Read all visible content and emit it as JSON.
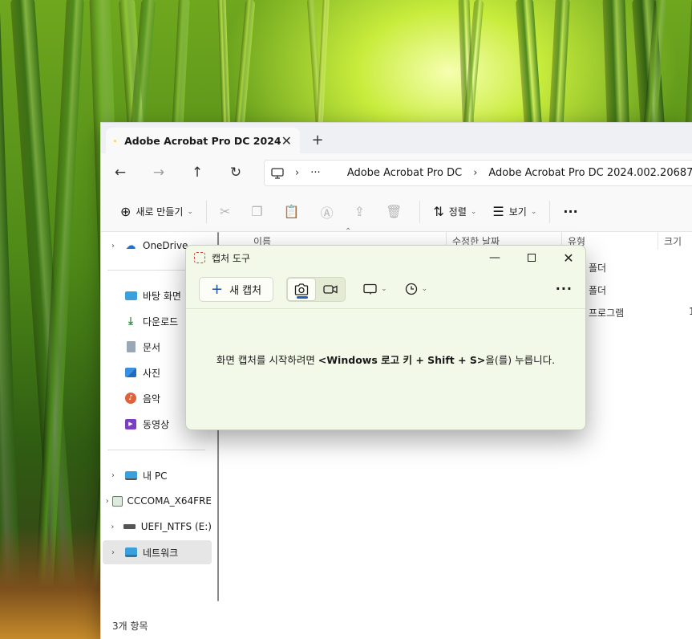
{
  "explorer": {
    "tab_title": "Adobe Acrobat Pro DC 2024",
    "tab_close": "✕",
    "new_tab": "+",
    "breadcrumb": {
      "overflow": "···",
      "items": [
        "Adobe Acrobat Pro DC",
        "Adobe Acrobat Pro DC 2024.002.20687"
      ]
    },
    "commands": {
      "new": "새로 만들기",
      "sort": "정렬",
      "view": "보기",
      "more": "···"
    },
    "sidebar": {
      "onedrive": "OneDrive",
      "quick": [
        "바탕 화면",
        "다운로드",
        "문서",
        "사진",
        "음악",
        "동영상"
      ],
      "devices": [
        "내 PC",
        "CCCOMA_X64FRE",
        "UEFI_NTFS (E:)",
        "네트워크"
      ]
    },
    "columns": {
      "name": "이름",
      "modified": "수정한 날짜",
      "type": "유형",
      "size": "크기"
    },
    "rows": [
      {
        "type": "폴더",
        "size": ""
      },
      {
        "type": "폴더",
        "size": ""
      },
      {
        "type": "프로그램",
        "size": "1"
      }
    ],
    "status": "3개 항목"
  },
  "snip": {
    "title": "캡처 도구",
    "new_capture": "새 캡처",
    "more": "···",
    "message": {
      "prefix": "화면 캡처를 시작하려면 ",
      "shortcut": "<Windows 로고 키 + Shift + S>",
      "suffix": "을(를) 누릅니다."
    }
  },
  "colors": {
    "snip_bg": "#f3f9e8",
    "accent": "#1f5fb8",
    "folder": "#f3c34b"
  }
}
